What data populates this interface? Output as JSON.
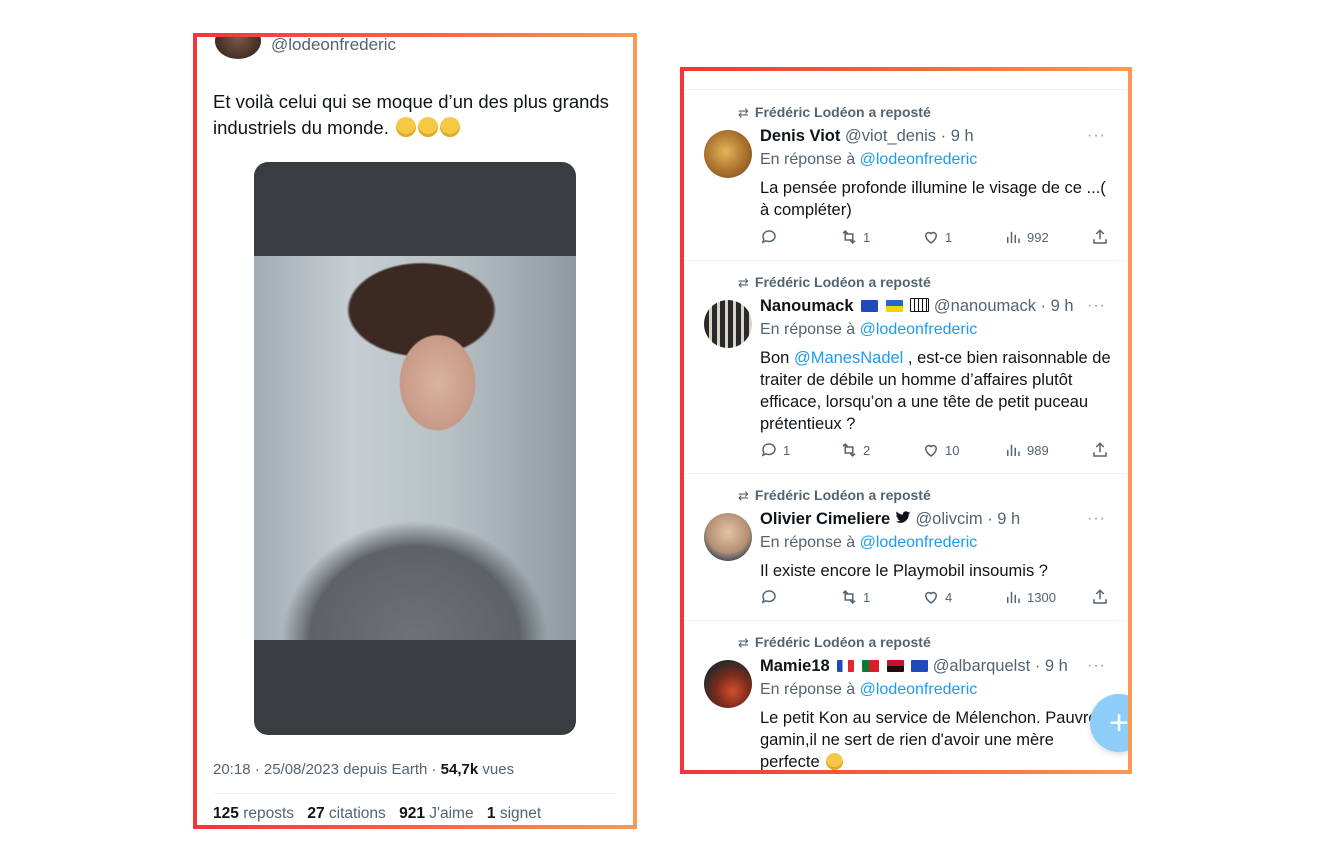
{
  "left": {
    "handle": "@lodeonfrederic",
    "tweet_text": "Et voilà celui qui se moque d’un des plus grands industriels du monde.",
    "emoji": [
      "rolling-on-floor-laughing",
      "rolling-on-floor-laughing",
      "rolling-on-floor-laughing"
    ],
    "meta_time": "20:18 · 25/08/2023 depuis Earth · ",
    "meta_views_value": "54,7k",
    "meta_views_label": " vues",
    "stats": {
      "reposts_value": "125",
      "reposts_label": "reposts",
      "quotes_value": "27",
      "quotes_label": "citations",
      "likes_value": "921",
      "likes_label": "J'aime",
      "bookmarks_value": "1",
      "bookmarks_label": "signet"
    }
  },
  "right": {
    "replies": [
      {
        "repost_label": "Frédéric Lodéon a reposté",
        "name": "Denis Viot",
        "handle_time": "@viot_denis · 9 h",
        "in_reply_prefix": "En réponse à ",
        "in_reply_mention": "@lodeonfrederic",
        "text": "La pensée profonde illumine le visage de ce ...( à compléter)",
        "replies": "",
        "reposts": "1",
        "likes": "1",
        "views": "992"
      },
      {
        "repost_label": "Frédéric Lodéon a reposté",
        "name": "Nanoumack",
        "flags": [
          "eu",
          "ukraine",
          "piano"
        ],
        "handle_time": "@nanoumack · 9 h",
        "in_reply_prefix": "En réponse à ",
        "in_reply_mention": "@lodeonfrederic",
        "text_prefix": "Bon ",
        "text_mention": "@ManesNadel",
        "text": " , est-ce bien raisonnable de traiter de débile un homme d’affaires plutôt efficace, lorsqu’on a une tête de petit puceau prétentieux ?",
        "replies": "1",
        "reposts": "2",
        "likes": "10",
        "views": "989"
      },
      {
        "repost_label": "Frédéric Lodéon a reposté",
        "name": "Olivier Cimeliere",
        "badge": "bird",
        "handle_time": "@olivcim · 9 h",
        "in_reply_prefix": "En réponse à ",
        "in_reply_mention": "@lodeonfrederic",
        "text": "Il existe encore le Playmobil insoumis ?",
        "replies": "",
        "reposts": "1",
        "likes": "4",
        "views": "1300"
      },
      {
        "repost_label": "Frédéric Lodéon a reposté",
        "name": "Mamie18",
        "flags": [
          "france",
          "portugal",
          "angola",
          "eu"
        ],
        "handle_time": "@albarquelst · 9 h",
        "in_reply_prefix": "En réponse à ",
        "in_reply_mention": "@lodeonfrederic",
        "text": "Le petit Kon au service de Mélenchon. Pauvre gamin,il ne sert de rien d'avoir une mère perfecte",
        "emoji": "face-with-tears-of-joy"
      }
    ],
    "fab_label": "+"
  },
  "colors": {
    "accent": "#1d9bf0",
    "secondary_text": "#536471",
    "frame_start": "#f2353a",
    "frame_end": "#fa9a52"
  }
}
